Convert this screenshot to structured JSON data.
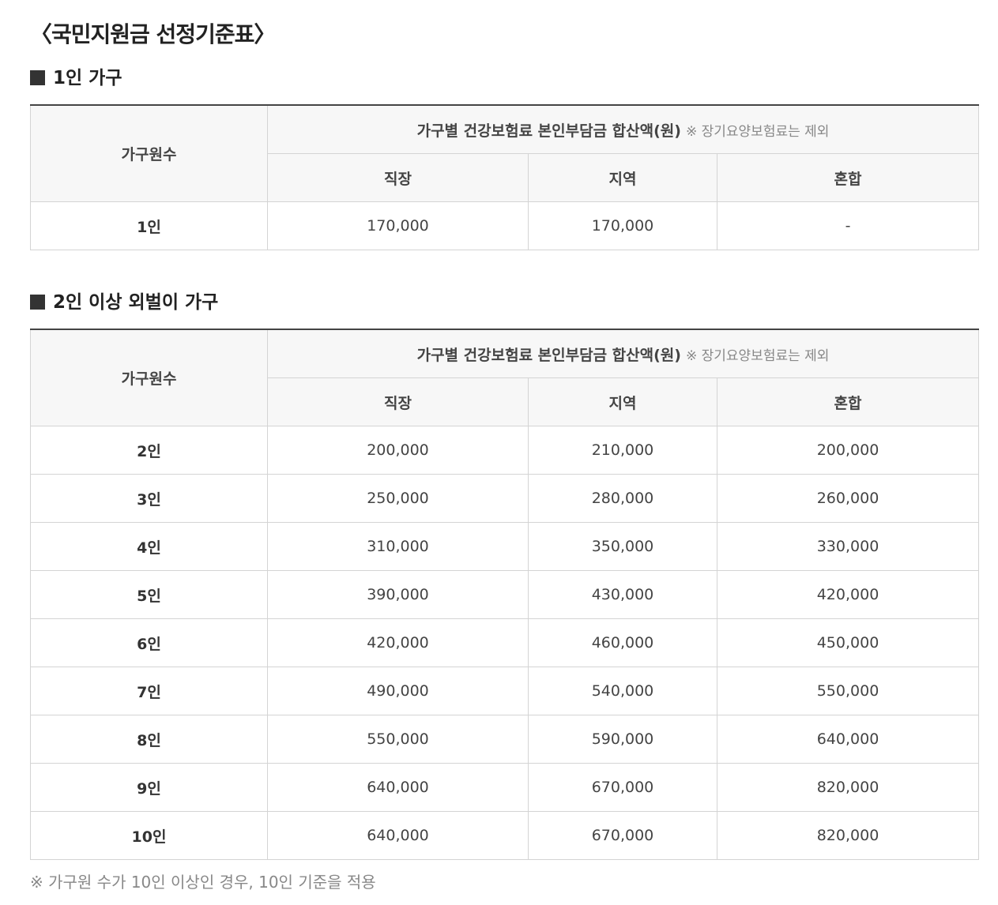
{
  "page_title": "〈국민지원금 선정기준표〉",
  "sections": [
    {
      "title": "1인 가구",
      "headers": {
        "row_label": "가구원수",
        "group": "가구별 건강보험료 본인부담금 합산액(원)",
        "group_note": "※ 장기요양보험료는 제외",
        "columns": [
          "직장",
          "지역",
          "혼합"
        ]
      },
      "rows": [
        {
          "label": "1인",
          "values": [
            "170,000",
            "170,000",
            "-"
          ]
        }
      ]
    },
    {
      "title": "2인 이상 외벌이 가구",
      "headers": {
        "row_label": "가구원수",
        "group": "가구별 건강보험료 본인부담금 합산액(원)",
        "group_note": "※ 장기요양보험료는 제외",
        "columns": [
          "직장",
          "지역",
          "혼합"
        ]
      },
      "rows": [
        {
          "label": "2인",
          "values": [
            "200,000",
            "210,000",
            "200,000"
          ]
        },
        {
          "label": "3인",
          "values": [
            "250,000",
            "280,000",
            "260,000"
          ]
        },
        {
          "label": "4인",
          "values": [
            "310,000",
            "350,000",
            "330,000"
          ]
        },
        {
          "label": "5인",
          "values": [
            "390,000",
            "430,000",
            "420,000"
          ]
        },
        {
          "label": "6인",
          "values": [
            "420,000",
            "460,000",
            "450,000"
          ]
        },
        {
          "label": "7인",
          "values": [
            "490,000",
            "540,000",
            "550,000"
          ]
        },
        {
          "label": "8인",
          "values": [
            "550,000",
            "590,000",
            "640,000"
          ]
        },
        {
          "label": "9인",
          "values": [
            "640,000",
            "670,000",
            "820,000"
          ]
        },
        {
          "label": "10인",
          "values": [
            "640,000",
            "670,000",
            "820,000"
          ]
        }
      ]
    }
  ],
  "footnote": "※ 가구원 수가 10인 이상인 경우, 10인 기준을 적용"
}
